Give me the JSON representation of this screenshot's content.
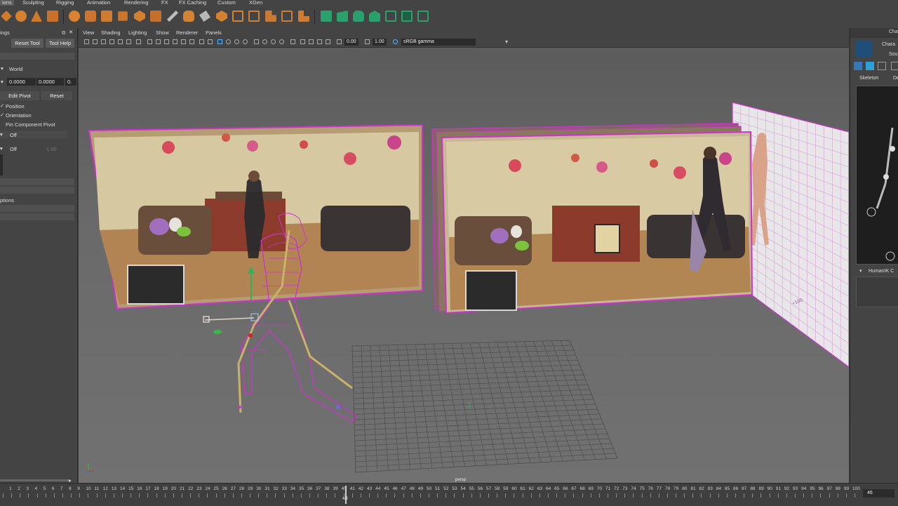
{
  "menu_tabs": [
    "ions",
    "Sculpting",
    "Rigging",
    "Animation",
    "Rendering",
    "FX",
    "FX Caching",
    "Custom",
    "XGen"
  ],
  "left_panel": {
    "title_fragment": "ings",
    "reset_tool": "Reset Tool",
    "tool_help": "Tool Help",
    "space": "World",
    "values": [
      "0.0000",
      "0.0000",
      "0."
    ],
    "edit_pivot": "Edit Pivot",
    "reset": "Reset",
    "checks": [
      "Position",
      "Orientation",
      "Pin Component Pivot"
    ],
    "off_1": "Off",
    "off_2": "Off",
    "off_2_value": "1.00",
    "options_fragment": "ptions"
  },
  "viewport": {
    "menu": [
      "View",
      "Shading",
      "Lighting",
      "Show",
      "Renderer",
      "Panels"
    ],
    "exposure": "0.00",
    "gamma": "1.00",
    "color_space": "sRGB gamma",
    "camera_label": "persp",
    "grid_label": "+100"
  },
  "right_panel": {
    "title_fragment": "Chara",
    "sub_fragment": "Sou",
    "tabs": [
      "Skeleton",
      "De"
    ],
    "section": "HumanIK C"
  },
  "timeline": {
    "start": 0,
    "end": 100,
    "current_frame": "46",
    "current_frame_field": "46"
  },
  "colors": {
    "ui_bg": "#444444",
    "viewport_bg": "#626262",
    "wireframe": "#cc33cc",
    "selection_highlight": "#5fb0ff",
    "shelf_green": "#2aa06c",
    "shelf_orange": "#d57a28"
  },
  "icons": {
    "shelf": [
      "shelf-tool-icon"
    ],
    "view_axis": "axis-gizmo-icon"
  }
}
